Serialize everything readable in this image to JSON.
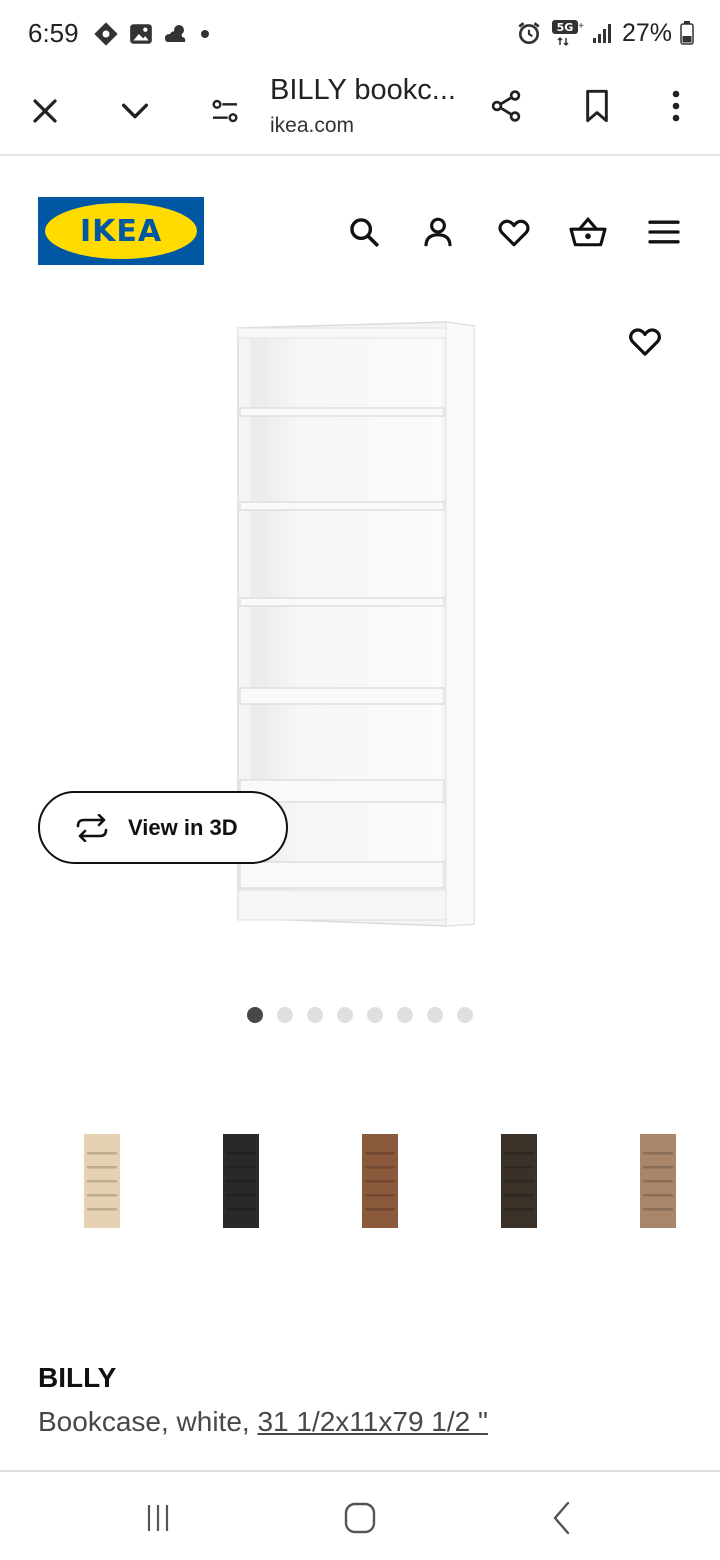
{
  "status_bar": {
    "time": "6:59",
    "battery": "27%",
    "network": "5G+"
  },
  "browser": {
    "page_title": "BILLY bookc...",
    "domain": "ikea.com",
    "icons": [
      "close-icon",
      "chevron-down-icon",
      "page-settings-icon",
      "share-icon",
      "bookmark-icon",
      "more-vert-icon"
    ]
  },
  "site_header": {
    "logo_text": "IKEA",
    "logo_colors": {
      "blue": "#0058a3",
      "yellow": "#ffdb00"
    },
    "icons": [
      "search-icon",
      "profile-icon",
      "heart-icon",
      "basket-icon",
      "menu-icon"
    ]
  },
  "product_media": {
    "view3d_label": "View in 3D",
    "image_count": 8,
    "active_image": 1
  },
  "variants": [
    {
      "name": "white-stained-oak",
      "color": "#e6d2b2"
    },
    {
      "name": "black-brown",
      "color": "#2a2a2a"
    },
    {
      "name": "brown-walnut",
      "color": "#8b5a3c"
    },
    {
      "name": "dark-brown",
      "color": "#3b3129"
    },
    {
      "name": "oak-veneer",
      "color": "#a9866a"
    }
  ],
  "product": {
    "name": "BILLY",
    "description_prefix": "Bookcase, white, ",
    "dimensions": "31 1/2x11x79 1/2 \""
  },
  "nav_bar": {
    "icons": [
      "recent-apps-icon",
      "home-icon",
      "back-icon"
    ]
  }
}
